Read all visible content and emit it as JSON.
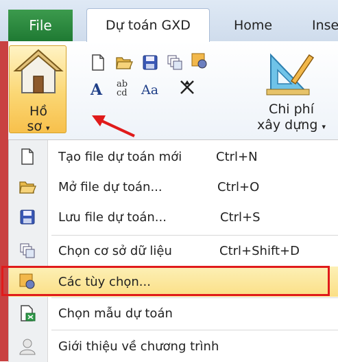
{
  "tabs": {
    "file": "File",
    "active": "Dự toán GXD",
    "home": "Home",
    "insert_partial": "Inse"
  },
  "ribbon": {
    "ho_so_line1": "Hồ",
    "ho_so_line2": "sơ",
    "chi_phi_line1": "Chi phí",
    "chi_phi_line2": "xây dựng",
    "font_a": "A",
    "font_ab": "ab",
    "font_cd": "cd",
    "font_aa": "Aa"
  },
  "menu": {
    "items": [
      {
        "label": "Tạo file dự toán mới",
        "shortcut": "Ctrl+N"
      },
      {
        "label": "Mở file dự toán...",
        "shortcut": "Ctrl+O"
      },
      {
        "label": "Lưu file dự toán...",
        "shortcut": "Ctrl+S"
      },
      {
        "label": "Chọn cơ sở dữ liệu",
        "shortcut": "Ctrl+Shift+D"
      },
      {
        "label": "Các tùy chọn...",
        "shortcut": ""
      },
      {
        "label": "Chọn mẫu dự toán",
        "shortcut": ""
      },
      {
        "label": "Giới thiệu về chương trình",
        "shortcut": ""
      }
    ]
  },
  "colors": {
    "file_tab": "#1f7a33",
    "highlight": "#fbdf86",
    "annotation_red": "#e01b1b"
  }
}
